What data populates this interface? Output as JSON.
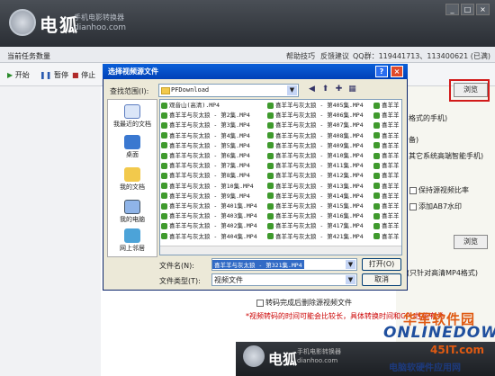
{
  "app": {
    "brand": "电狐",
    "subtitle": "手机电影转换器",
    "url": "dianhoo.com"
  },
  "window_buttons": [
    "_",
    "□",
    "×"
  ],
  "infobar": {
    "task_label": "当前任务数量",
    "help": "帮助技巧",
    "feedback": "反馈建议",
    "qq": "QQ群：119441713、113400621 (已满)"
  },
  "toolbar": {
    "start": "开始",
    "pause": "暂停",
    "stop": "停止"
  },
  "right_panel": {
    "browse_label": "浏览",
    "lines": [
      "格式的手机)",
      "备)",
      "其它系统高端智能手机)",
      "(只针对高清MP4格式)"
    ],
    "keep_ratio": "保持源视频比率",
    "add_watermark": "添加AB7水印"
  },
  "dialog": {
    "title": "选择视频源文件",
    "lookin_label": "查找范围(I):",
    "folder": "PFDownload",
    "help_btn": "?",
    "close_btn": "×",
    "places": [
      "我最近的文档",
      "桌面",
      "我的文档",
      "我的电脑",
      "网上邻居"
    ],
    "columns": [
      [
        "观音山(高清).MP4",
        "喜羊羊与灰太狼 - 第2集.MP4",
        "喜羊羊与灰太狼 - 第3集.MP4",
        "喜羊羊与灰太狼 - 第4集.MP4",
        "喜羊羊与灰太狼 - 第5集.MP4",
        "喜羊羊与灰太狼 - 第6集.MP4",
        "喜羊羊与灰太狼 - 第7集.MP4",
        "喜羊羊与灰太狼 - 第8集.MP4",
        "喜羊羊与灰太狼 - 第10集.MP4",
        "喜羊羊与灰太狼 - 第9集.MP4",
        "喜羊羊与灰太狼 - 第401集.MP4",
        "喜羊羊与灰太狼 - 第403集.MP4",
        "喜羊羊与灰太狼 - 第402集.MP4",
        "喜羊羊与灰太狼 - 第404集.MP4"
      ],
      [
        "喜羊羊与灰太狼 - 第405集.MP4",
        "喜羊羊与灰太狼 - 第406集.MP4",
        "喜羊羊与灰太狼 - 第407集.MP4",
        "喜羊羊与灰太狼 - 第408集.MP4",
        "喜羊羊与灰太狼 - 第409集.MP4",
        "喜羊羊与灰太狼 - 第410集.MP4",
        "喜羊羊与灰太狼 - 第411集.MP4",
        "喜羊羊与灰太狼 - 第412集.MP4",
        "喜羊羊与灰太狼 - 第413集.MP4",
        "喜羊羊与灰太狼 - 第414集.MP4",
        "喜羊羊与灰太狼 - 第415集.MP4",
        "喜羊羊与灰太狼 - 第416集.MP4",
        "喜羊羊与灰太狼 - 第417集.MP4",
        "喜羊羊与灰太狼 - 第421集.MP4"
      ],
      [
        "喜羊羊",
        "喜羊羊",
        "喜羊羊",
        "喜羊羊",
        "喜羊羊",
        "喜羊羊",
        "喜羊羊",
        "喜羊羊",
        "喜羊羊",
        "喜羊羊",
        "喜羊羊",
        "喜羊羊",
        "喜羊羊",
        "喜羊羊"
      ]
    ],
    "filename_label": "文件名(N):",
    "filename_value": "喜羊羊与灰太狼 - 第321集.MP4",
    "filetype_label": "文件类型(T):",
    "filetype_value": "视频文件",
    "open": "打开(O)",
    "cancel": "取消"
  },
  "below": {
    "delete_check": "转码完成后删除源视频文件",
    "tip": "*视频转码的时间可能会比较长，具体转换时间和CPU性能有关"
  },
  "watermark": {
    "cn": "华军软件园",
    "latin": "ONLINEDOWN",
    "site": "45IT.com",
    "slogan": "电脑软硬件应用网"
  }
}
